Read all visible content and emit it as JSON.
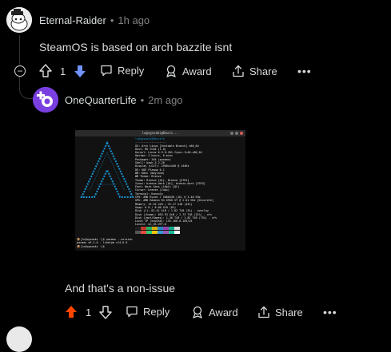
{
  "comment1": {
    "author": "Eternal-Raider",
    "age": "1h ago",
    "text": "SteamOS is based on arch bazzite isnt",
    "votes": "1",
    "reply_label": "Reply",
    "award_label": "Award",
    "share_label": "Share",
    "more_label": "•••"
  },
  "comment2": {
    "author": "OneQuarterLife",
    "age": "2m ago",
    "text": "And that's a non-issue",
    "votes": "1",
    "reply_label": "Reply",
    "award_label": "Award",
    "share_label": "Share",
    "more_label": "•••",
    "attachment": {
      "window_title": "lu@vgsoaki@Bazzi...",
      "info_lines": [
        "lu@vgsoaki@Bazzite",
        "-------------------",
        "OS: Arch Linux [Unstable Branch] x86_64",
        "Host: MS-7C84 (1.0)",
        "Kernel: Linux 6.9.6-201.fsync.fc40.x86_64",
        "Uptime: 2 hours, 6 mins",
        "Packages: 264 (pacman)",
        "Shell: bash 5.2.26",
        "Display (LG27): 2560x1440 @ 144Hz",
        "DE: KDE Plasma 6.1",
        "WM: KWin (Wayland)",
        "WM Theme: Breeze",
        "Theme: Breeze [Qt], Breeze [GTK3]",
        "Icons: breeze-dark [Qt], breeze-dark [GTK3]",
        "Font: Noto Sans (10pt) [Qt]",
        "Cursor: breeze (24px)",
        "Terminal: Konsole",
        "CPU: AMD Ryzen 7 5800X3D (16) @ 3.40 GHz",
        "GPU: AMD Radeon RX 6950 XT @ 2.61 GHz [Discrete]",
        "Memory: 13.54 GiB / 31.27 GiB (43%)",
        "Swap: 0 B / 8.00 GiB (0%)",
        "Disk (/): 61.41 GiB / 1.82 TiB (3%) - overlay",
        "Disk (/home): 853.93 GiB / 2.73 TiB (31%) - xfs",
        "Disk (/mnt/Games): 1.36 TiB / 1.82 TiB (75%) - xfs",
        "Local IP (enp5s0): 192.168.0.105/24",
        "Locale: en_US.UTF-8"
      ],
      "prompt_lines": [
        "📦[lu@vgsoaki ~]$ pacman --version",
        "pacman v6.1.0 - libalpm v14.0.0",
        "📦[lu@vgsoaki ~]$"
      ]
    }
  },
  "colors": {
    "upvote_active": "#ff4500",
    "downvote_active": "#7193ff",
    "avatar2": "#7a3fe0",
    "logo_blue": "#1793d1"
  }
}
